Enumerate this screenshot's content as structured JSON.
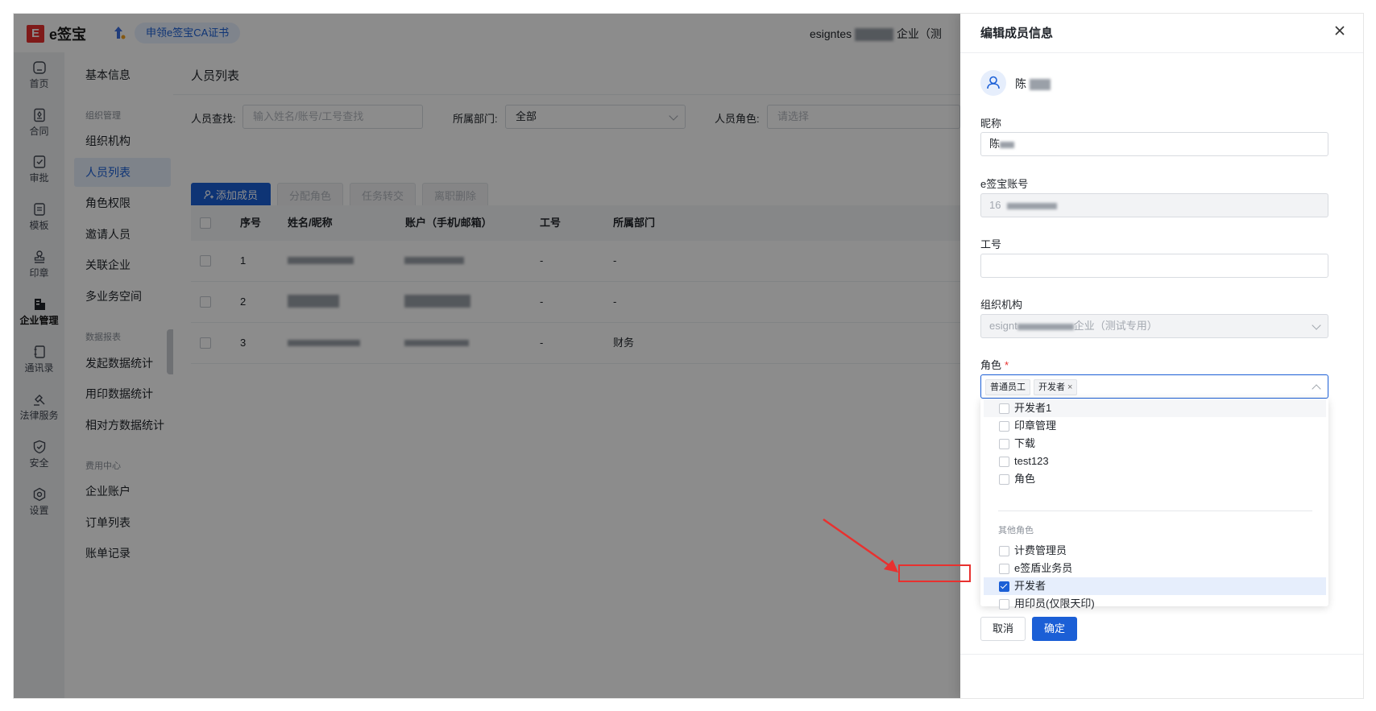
{
  "app": {
    "logo_mark": "E",
    "logo_text": "e签宝",
    "ca_button": "申领e签宝CA证书",
    "company_prefix": "esigntes",
    "company_suffix": "企业（测"
  },
  "rail": [
    {
      "label": "首页",
      "icon": "home-icon"
    },
    {
      "label": "合同",
      "icon": "contract-icon"
    },
    {
      "label": "审批",
      "icon": "approval-icon"
    },
    {
      "label": "模板",
      "icon": "template-icon"
    },
    {
      "label": "印章",
      "icon": "seal-icon"
    },
    {
      "label": "企业管理",
      "icon": "enterprise-icon"
    },
    {
      "label": "通讯录",
      "icon": "contacts-icon"
    },
    {
      "label": "法律服务",
      "icon": "legal-icon"
    },
    {
      "label": "安全",
      "icon": "security-icon"
    },
    {
      "label": "设置",
      "icon": "settings-icon"
    }
  ],
  "sidebar": {
    "items": [
      "基本信息",
      "组织机构",
      "人员列表",
      "角色权限",
      "邀请人员",
      "关联企业",
      "多业务空间",
      "发起数据统计",
      "用印数据统计",
      "相对方数据统计",
      "企业账户",
      "订单列表",
      "账单记录"
    ],
    "groups": [
      "组织管理",
      "数据报表",
      "费用中心"
    ]
  },
  "main": {
    "title": "人员列表",
    "filters": {
      "search_label": "人员查找:",
      "search_placeholder": "输入姓名/账号/工号查找",
      "dept_label": "所属部门:",
      "dept_value": "全部",
      "role_label": "人员角色:",
      "role_placeholder": "请选择"
    },
    "buttons": {
      "add": "添加成员",
      "assign": "分配角色",
      "transfer": "任务转交",
      "resign": "离职删除"
    },
    "columns": [
      "序号",
      "姓名/昵称",
      "账户（手机/邮箱）",
      "工号",
      "所属部门"
    ],
    "rows": [
      {
        "index": "1",
        "job_no": "-",
        "dept": "-"
      },
      {
        "index": "2",
        "job_no": "-",
        "dept": "-"
      },
      {
        "index": "3",
        "job_no": "-",
        "dept": "财务"
      }
    ]
  },
  "drawer": {
    "title": "编辑成员信息",
    "user_initial": "陈",
    "nickname_label": "昵称",
    "nickname_value": "陈",
    "account_label": "e签宝账号",
    "account_value": "16",
    "job_label": "工号",
    "job_value": "",
    "org_label": "组织机构",
    "org_prefix": "esignt",
    "org_suffix": "企业（测试专用）",
    "role_label": "角色",
    "role_tags": [
      "普通员工",
      "开发者"
    ],
    "options_a": [
      "开发者1",
      "印章管理",
      "下载",
      "test123",
      "角色"
    ],
    "group_other": "其他角色",
    "options_b": [
      "计费管理员",
      "e签盾业务员",
      "开发者",
      "用印员(仅限天印)"
    ],
    "checked_option": "开发者",
    "cancel": "取消",
    "confirm": "确定"
  },
  "colors": {
    "primary": "#1b5fd6",
    "danger": "#e8312f"
  }
}
